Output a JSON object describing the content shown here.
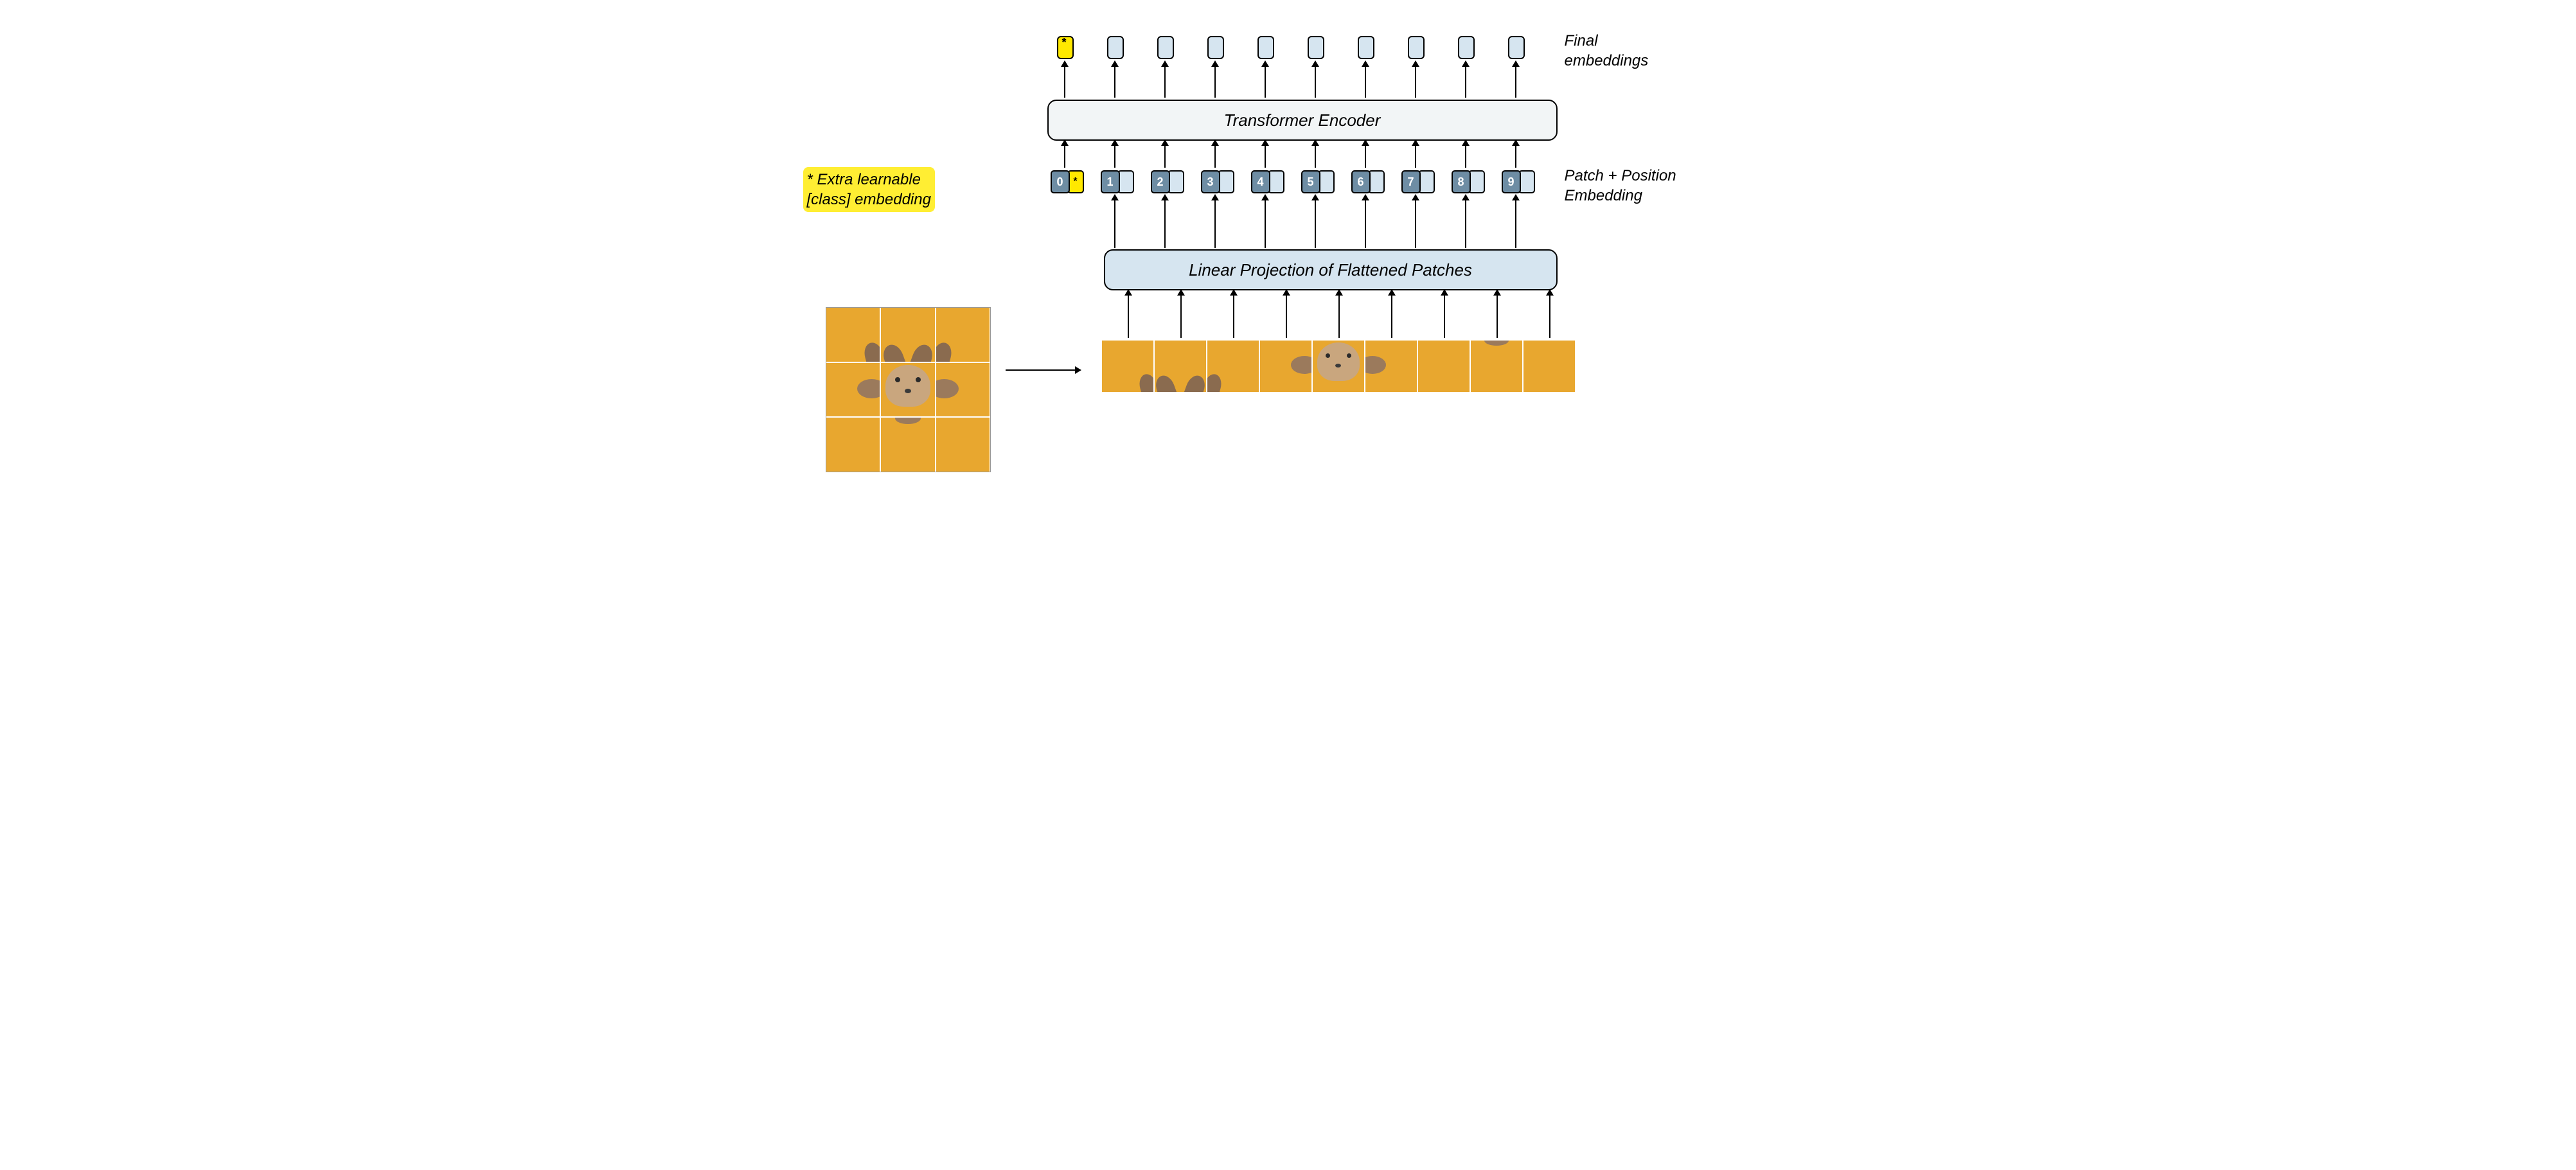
{
  "labels": {
    "final_embeddings_line1": "Final",
    "final_embeddings_line2": "embeddings",
    "transformer_encoder": "Transformer Encoder",
    "class_embedding_line1": "* Extra learnable",
    "class_embedding_line2": "[class] embedding",
    "patch_position_line1": "Patch + Position",
    "patch_position_line2": "Embedding",
    "linear_projection": "Linear Projection of Flattened Patches",
    "class_token_symbol": "*"
  },
  "position_tokens": [
    "0",
    "1",
    "2",
    "3",
    "4",
    "5",
    "6",
    "7",
    "8",
    "9"
  ],
  "num_tokens": 10,
  "num_image_patches": 9,
  "colors": {
    "yellow_highlight": "#ffee33",
    "token_blue": "#d6e5f0",
    "position_blue": "#6e8da4",
    "encoder_bg": "#f2f5f6",
    "image_bg": "#e8a72f",
    "dog_brown": "#9b7a5c"
  }
}
